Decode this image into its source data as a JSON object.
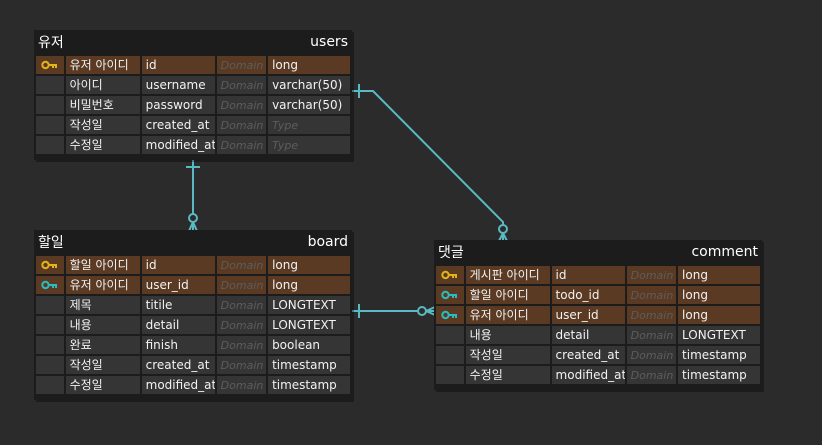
{
  "colors": {
    "background": "#2b2b2b",
    "entity": "#1c1c1c",
    "row": "#353535",
    "key_row": "#5a3a22",
    "primary_key": "#e3b417",
    "foreign_key": "#2bbcc1",
    "edge": "#5ab9c2"
  },
  "entities": [
    {
      "id": "users",
      "logical": "유저",
      "physical": "users",
      "columns": [
        {
          "logical": "유저 아이디",
          "physical": "id",
          "domain": "Domain",
          "type": "long",
          "key": "pk"
        },
        {
          "logical": "아이디",
          "physical": "username",
          "domain": "Domain",
          "type": "varchar(50)",
          "key": ""
        },
        {
          "logical": "비밀번호",
          "physical": "password",
          "domain": "Domain",
          "type": "varchar(50)",
          "key": ""
        },
        {
          "logical": "작성일",
          "physical": "created_at",
          "domain": "Domain",
          "type": "Type",
          "key": "",
          "type_placeholder": true
        },
        {
          "logical": "수정일",
          "physical": "modified_at",
          "domain": "Domain",
          "type": "Type",
          "key": "",
          "type_placeholder": true
        }
      ]
    },
    {
      "id": "board",
      "logical": "할일",
      "physical": "board",
      "columns": [
        {
          "logical": "할일 아이디",
          "physical": "id",
          "domain": "Domain",
          "type": "long",
          "key": "pk"
        },
        {
          "logical": "유저 아이디",
          "physical": "user_id",
          "domain": "Domain",
          "type": "long",
          "key": "fk"
        },
        {
          "logical": "제목",
          "physical": "titile",
          "domain": "Domain",
          "type": "LONGTEXT",
          "key": ""
        },
        {
          "logical": "내용",
          "physical": "detail",
          "domain": "Domain",
          "type": "LONGTEXT",
          "key": ""
        },
        {
          "logical": "완료",
          "physical": "finish",
          "domain": "Domain",
          "type": "boolean",
          "key": ""
        },
        {
          "logical": "작성일",
          "physical": "created_at",
          "domain": "Domain",
          "type": "timestamp",
          "key": ""
        },
        {
          "logical": "수정일",
          "physical": "modified_at",
          "domain": "Domain",
          "type": "timestamp",
          "key": ""
        }
      ]
    },
    {
      "id": "comment",
      "logical": "댓글",
      "physical": "comment",
      "columns": [
        {
          "logical": "게시판 아이디",
          "physical": "id",
          "domain": "Domain",
          "type": "long",
          "key": "pk"
        },
        {
          "logical": "할일 아이디",
          "physical": "todo_id",
          "domain": "Domain",
          "type": "long",
          "key": "fk"
        },
        {
          "logical": "유저 아이디",
          "physical": "user_id",
          "domain": "Domain",
          "type": "long",
          "key": "fk"
        },
        {
          "logical": "내용",
          "physical": "detail",
          "domain": "Domain",
          "type": "LONGTEXT",
          "key": ""
        },
        {
          "logical": "작성일",
          "physical": "created_at",
          "domain": "Domain",
          "type": "timestamp",
          "key": ""
        },
        {
          "logical": "수정일",
          "physical": "modified_at",
          "domain": "Domain",
          "type": "timestamp",
          "key": ""
        }
      ]
    }
  ],
  "relationships": [
    {
      "from": "users",
      "to": "board",
      "start": "one",
      "end": "zero-or-many"
    },
    {
      "from": "users",
      "to": "comment",
      "start": "one",
      "end": "zero-or-many"
    },
    {
      "from": "board",
      "to": "comment",
      "start": "one",
      "end": "zero-or-many"
    }
  ]
}
